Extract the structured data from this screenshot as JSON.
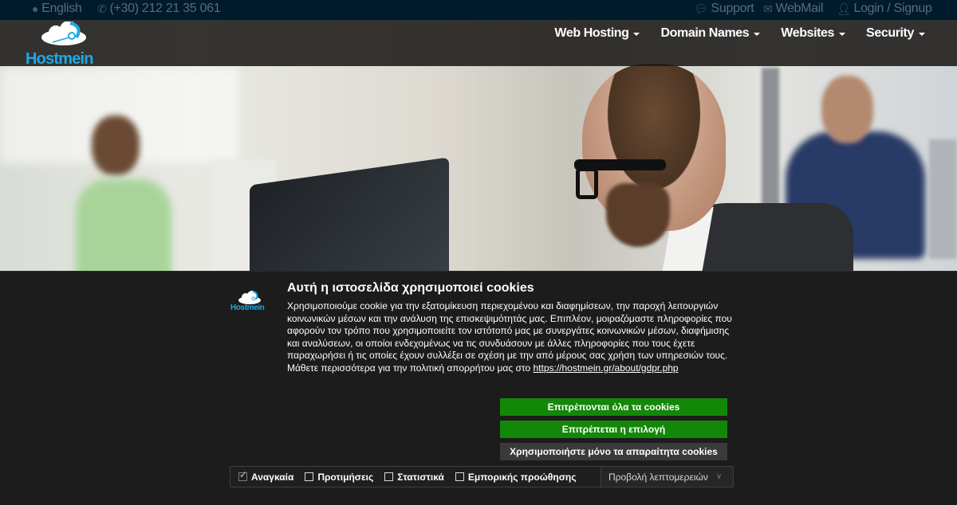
{
  "topbar": {
    "language": {
      "icon": "globe-icon",
      "label": "English"
    },
    "phone": {
      "icon": "phone-icon",
      "label": "(+30) 212 21 35 061"
    },
    "support": {
      "icon": "chat-bubbles-icon",
      "label": "Support"
    },
    "webmail": {
      "icon": "envelope-icon",
      "label": "WebMail"
    },
    "login": {
      "icon": "user-icon",
      "label": "Login / Signup"
    }
  },
  "header": {
    "logo_text": "Hostmein",
    "nav": [
      {
        "label": "Web Hosting"
      },
      {
        "label": "Domain Names"
      },
      {
        "label": "Websites"
      },
      {
        "label": "Security"
      }
    ]
  },
  "cookie": {
    "logo_text": "Hostmein",
    "title": "Αυτή η ιστοσελίδα χρησιμοποιεί cookies",
    "body": "Χρησιμοποιούμε cookie για την εξατομίκευση περιεχομένου και διαφημίσεων, την παροχή λειτουργιών κοινωνικών μέσων και την ανάλυση της επισκεψιμότητάς μας. Επιπλέον, μοιραζόμαστε πληροφορίες που αφορούν τον τρόπο που χρησιμοποιείτε τον ιστότοπό μας με συνεργάτες κοινωνικών μέσων, διαφήμισης και αναλύσεων, οι οποίοι ενδεχομένως να τις συνδυάσουν με άλλες πληροφορίες που τους έχετε παραχωρήσει ή τις οποίες έχουν συλλέξει σε σχέση με την από μέρους σας χρήση των υπηρεσιών τους. Μάθετε περισσότερα για την πολιτική απορρήτου μας στο",
    "policy_link": "https://hostmein.gr/about/gdpr.php",
    "buttons": {
      "allow_all": "Επιτρέπονται όλα τα cookies",
      "allow_selection": "Επιτρέπεται η επιλογή",
      "necessary_only": "Χρησιμοποιήστε μόνο τα απαραίτητα cookies"
    },
    "preferences": [
      {
        "label": "Αναγκαία",
        "checked": true
      },
      {
        "label": "Προτιμήσεις",
        "checked": false
      },
      {
        "label": "Στατιστικά",
        "checked": false
      },
      {
        "label": "Εμπορικής προώθησης",
        "checked": false
      }
    ],
    "details_label": "Προβολή λεπτομερειών"
  },
  "colors": {
    "topbar_bg": "#001a2e",
    "brand_blue": "#1ea8e6",
    "accept_green": "#138808",
    "banner_bg": "#1c1c1c"
  }
}
